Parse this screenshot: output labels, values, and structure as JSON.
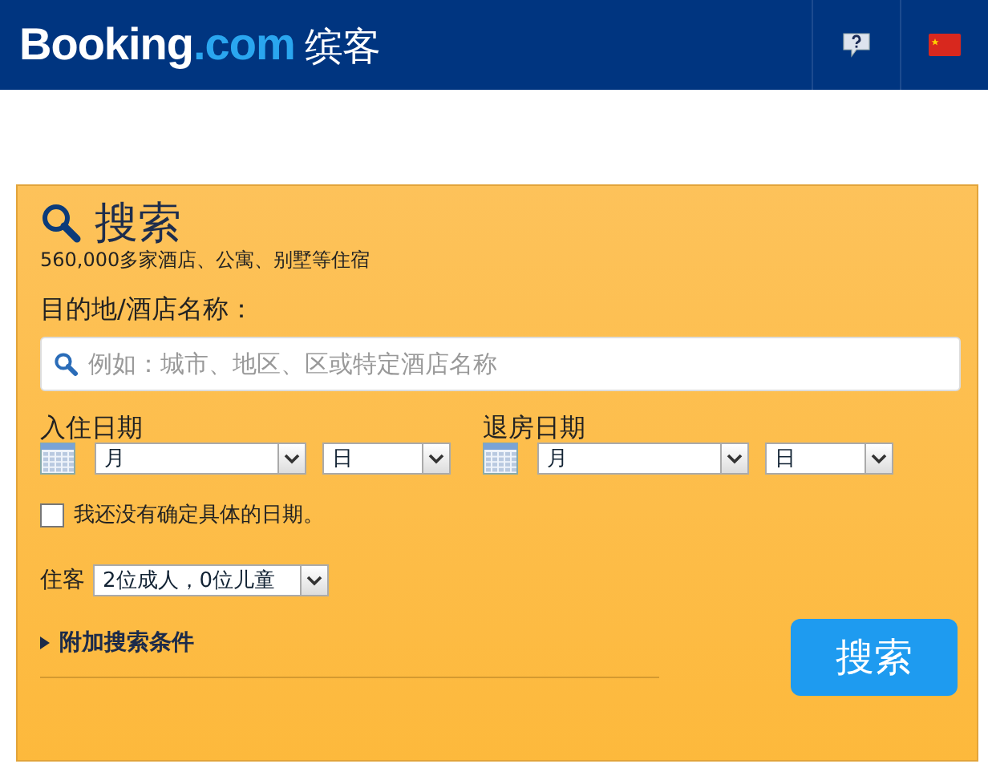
{
  "header": {
    "logo": {
      "brand": "Booking",
      "suffix": ".com",
      "local": "缤客"
    }
  },
  "search": {
    "title": "搜索",
    "subtitle": "560,000多家酒店、公寓、别墅等住宿",
    "destination_label": "目的地/酒店名称：",
    "destination_placeholder": "例如：城市、地区、区或特定酒店名称",
    "dates": [
      {
        "label": "入住日期",
        "month": "月",
        "day": "日"
      },
      {
        "label": "退房日期",
        "month": "月",
        "day": "日"
      }
    ],
    "no_dates": {
      "label": "我还没有确定具体的日期。",
      "checked": false
    },
    "guests_label": "住客",
    "guests_value": "2位成人，0位儿童",
    "more_options": "附加搜索条件",
    "button": "搜索"
  }
}
